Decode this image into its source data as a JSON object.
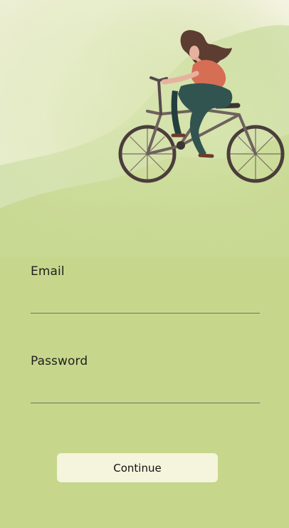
{
  "colors": {
    "background": "#c6d78c",
    "sky": "#f4f2dc",
    "hill": "#c9dd9f",
    "button": "#f5f4dc",
    "line": "#6f735e"
  },
  "illustration": {
    "name": "cyclist-on-hill"
  },
  "form": {
    "email": {
      "label": "Email",
      "value": "",
      "placeholder": ""
    },
    "password": {
      "label": "Password",
      "value": "",
      "placeholder": ""
    },
    "continue_label": "Continue"
  }
}
